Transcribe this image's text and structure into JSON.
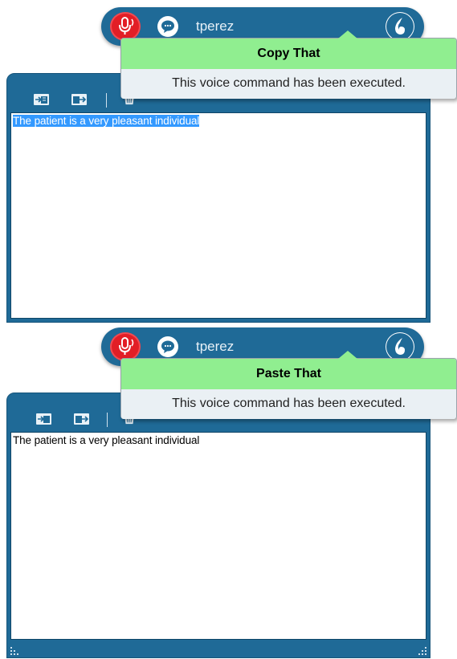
{
  "screenshots": [
    {
      "dragon_bar": {
        "username": "tperez",
        "mic_icon": "microphone-icon",
        "message_icon": "speech-bubble-icon",
        "logo_icon": "dragon-flame-icon"
      },
      "notification": {
        "title": "Copy That",
        "message": "This voice command has been executed."
      },
      "dictation_box": {
        "toolbar_icons": [
          "transfer-in-icon",
          "transfer-out-icon",
          "trash-icon"
        ],
        "text": "The patient is a very pleasant individual",
        "text_selected": true
      }
    },
    {
      "dragon_bar": {
        "username": "tperez",
        "mic_icon": "microphone-icon",
        "message_icon": "speech-bubble-icon",
        "logo_icon": "dragon-flame-icon"
      },
      "notification": {
        "title": "Paste That",
        "message": "This voice command has been executed."
      },
      "dictation_box": {
        "toolbar_icons": [
          "transfer-in-icon",
          "transfer-out-icon",
          "trash-icon"
        ],
        "text": "The patient is a very pleasant individual",
        "text_selected": false
      }
    }
  ],
  "colors": {
    "bar_blue": "#1f6a97",
    "mic_red": "#e21e26",
    "notification_green": "#90ee90",
    "selection_blue": "#3399ff"
  }
}
